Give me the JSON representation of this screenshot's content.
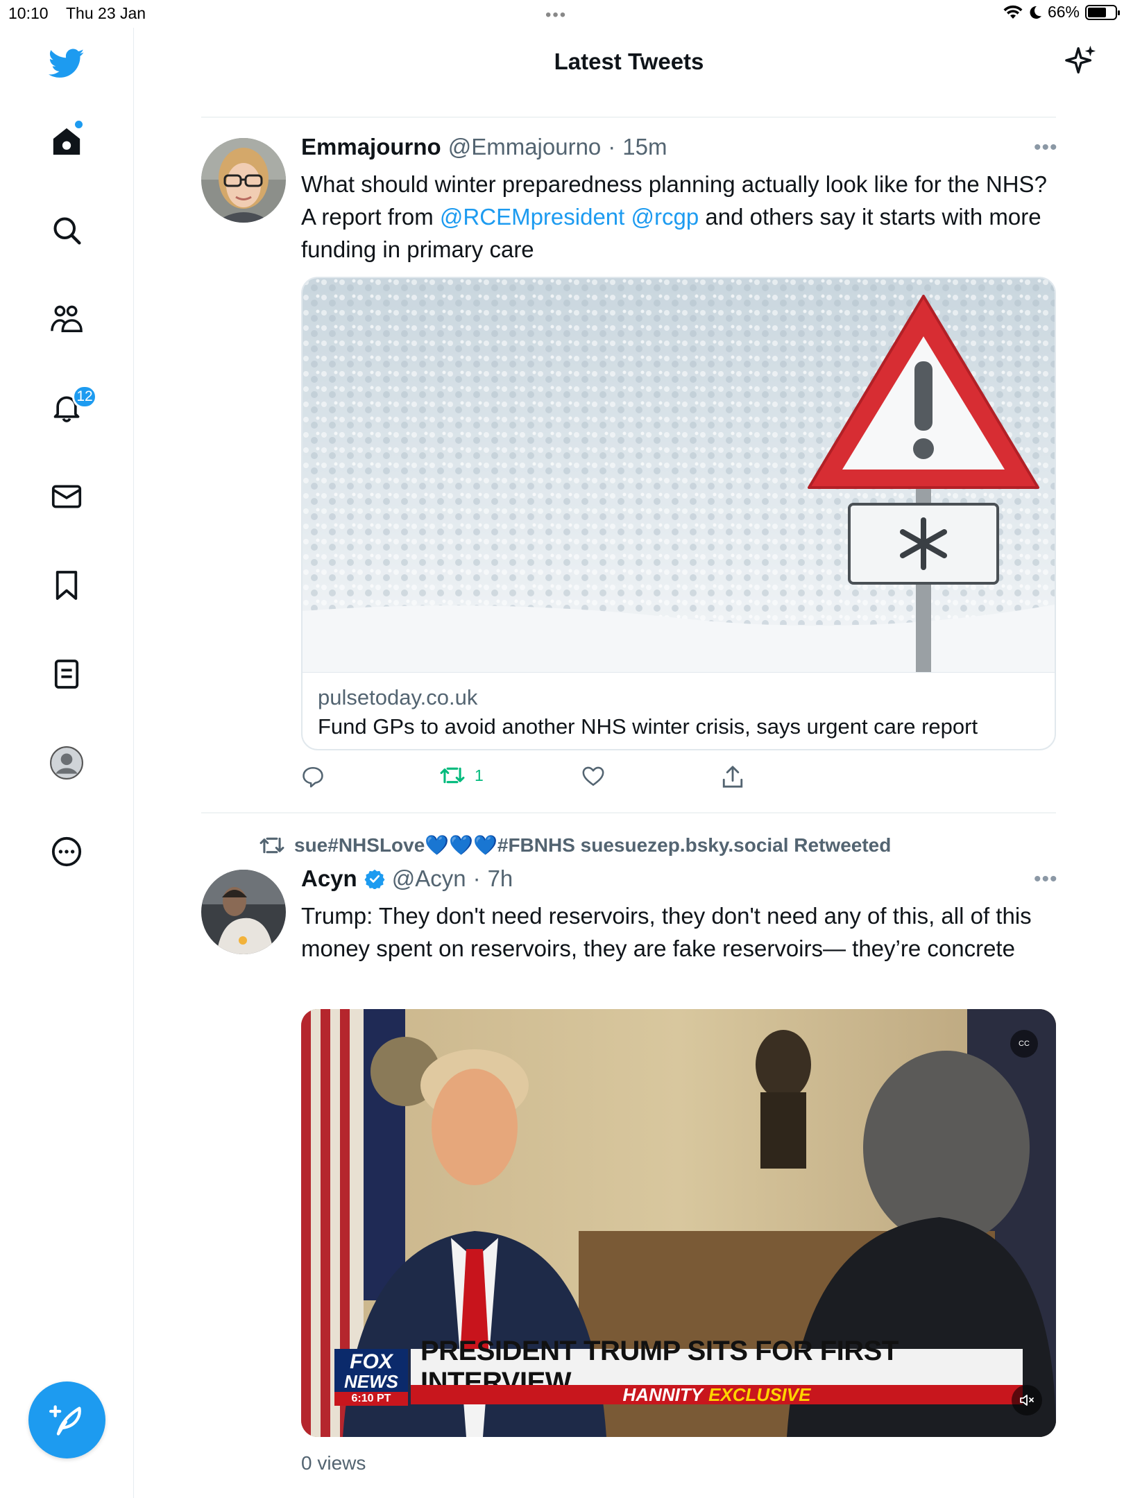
{
  "status_bar": {
    "time": "10:10",
    "date": "Thu 23 Jan",
    "battery": "66%",
    "battery_level": 0.66
  },
  "sidebar": {
    "notification_count": "12",
    "items": [
      "twitter-logo",
      "home",
      "search",
      "communities",
      "notifications",
      "messages",
      "bookmarks",
      "lists",
      "profile",
      "more"
    ]
  },
  "header": {
    "title": "Latest Tweets"
  },
  "tweets": [
    {
      "name": "Emmajourno",
      "handle": "@Emmajourno",
      "time": "15m",
      "text_before": "What should winter preparedness planning actually look like for the NHS? A report from ",
      "mention1": "@RCEMpresident",
      "mention2": "@rcgp",
      "text_after": " and others say it starts with more funding in primary care",
      "card": {
        "domain": "pulsetoday.co.uk",
        "title": "Fund GPs to avoid another NHS winter crisis, says urgent care report"
      },
      "retweets": "1"
    },
    {
      "retweeted_by": "sue#NHSLove💙💙💙#FBNHS suesuezep.bsky.social Retweeted",
      "name": "Acyn",
      "handle": "@Acyn",
      "time": "7h",
      "text": "Trump: They don't need reservoirs, they don't need any of this, all of this money spent on reservoirs, they are fake reservoirs— they’re concrete",
      "video": {
        "headline": "PRESIDENT TRUMP SITS FOR FIRST INTERVIEW",
        "sub1": "HANNITY",
        "sub2": "EXCLUSIVE",
        "network1": "FOX",
        "network2": "NEWS",
        "air_time": "6:10 PT",
        "cc": "CC"
      },
      "views": "0 views"
    }
  ],
  "colors": {
    "accent": "#1d9bf0",
    "retweet_green": "#00ba7c",
    "secondary_text": "#536471"
  }
}
